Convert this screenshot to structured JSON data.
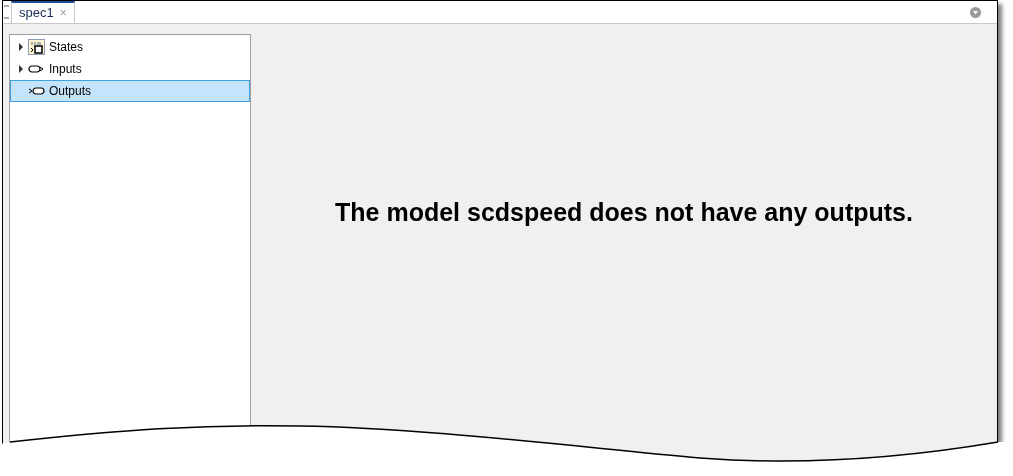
{
  "tabs": [
    {
      "label": "spec1",
      "selected": true,
      "close": "×"
    }
  ],
  "tree": {
    "items": [
      {
        "label": "States",
        "kind": "states",
        "expandable": true,
        "selected": false
      },
      {
        "label": "Inputs",
        "kind": "inputs",
        "expandable": true,
        "selected": false
      },
      {
        "label": "Outputs",
        "kind": "outputs",
        "expandable": false,
        "selected": true
      }
    ]
  },
  "message": "The model scdspeed does not have any outputs."
}
